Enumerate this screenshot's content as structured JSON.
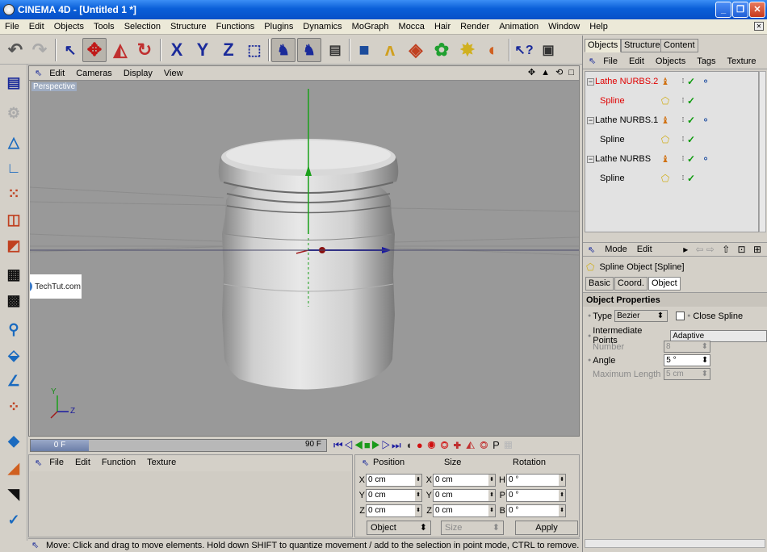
{
  "window": {
    "title": "CINEMA 4D - [Untitled 1 *]",
    "min_glyph": "_",
    "max_glyph": "❐",
    "close_glyph": "✕"
  },
  "menubar": {
    "items": [
      "File",
      "Edit",
      "Objects",
      "Tools",
      "Selection",
      "Structure",
      "Functions",
      "Plugins",
      "Dynamics",
      "MoGraph",
      "Mocca",
      "Hair",
      "Render",
      "Animation",
      "Window",
      "Help"
    ]
  },
  "toolbar": {
    "icons": [
      "undo-icon",
      "redo-icon",
      "pointer-icon",
      "move-icon",
      "scale-icon",
      "rotate-icon",
      "x-axis-icon",
      "y-axis-icon",
      "z-axis-icon",
      "world-coords-icon",
      "render-view-icon",
      "render-picture-icon",
      "render-settings-icon",
      "cube-icon",
      "spline-pen-icon",
      "nurbs-icon",
      "array-icon",
      "deformer-icon",
      "light-icon",
      "scene-icon",
      "help-icon",
      "info-icon"
    ]
  },
  "viewport": {
    "menu": [
      "Edit",
      "Cameras",
      "Display",
      "View"
    ],
    "label": "Perspective",
    "nav_glyphs": [
      "✥",
      "▲",
      "⟲",
      "□"
    ],
    "watermark": "TechTut.com"
  },
  "timeline": {
    "current_frame": "0 F",
    "end_frame": "90 F"
  },
  "material_manager": {
    "menu": [
      "File",
      "Edit",
      "Function",
      "Texture"
    ]
  },
  "coordinates": {
    "headers": [
      "Position",
      "Size",
      "Rotation"
    ],
    "rows": [
      {
        "pos_label": "X",
        "pos": "0 cm",
        "size_label": "X",
        "size": "0 cm",
        "rot_label": "H",
        "rot": "0 °"
      },
      {
        "pos_label": "Y",
        "pos": "0 cm",
        "size_label": "Y",
        "size": "0 cm",
        "rot_label": "P",
        "rot": "0 °"
      },
      {
        "pos_label": "Z",
        "pos": "0 cm",
        "size_label": "Z",
        "size": "0 cm",
        "rot_label": "B",
        "rot": "0 °"
      }
    ],
    "mode": "Object",
    "size_mode": "Size",
    "apply": "Apply"
  },
  "status_bar": {
    "text": "Move: Click and drag to move elements. Hold down SHIFT to quantize movement / add to the selection in point mode, CTRL to remove."
  },
  "object_manager": {
    "tabs": [
      "Objects",
      "Structure",
      "Content"
    ],
    "menu": [
      "File",
      "Edit",
      "Objects",
      "Tags",
      "Texture"
    ],
    "objects": [
      {
        "name": "Lathe NURBS.2",
        "selected": true
      },
      {
        "name": "Spline",
        "selected": true
      },
      {
        "name": "Lathe NURBS.1",
        "selected": false
      },
      {
        "name": "Spline",
        "selected": false
      },
      {
        "name": "Lathe NURBS",
        "selected": false
      },
      {
        "name": "Spline",
        "selected": false
      }
    ],
    "selected_color": "#e00000"
  },
  "attributes": {
    "menu": [
      "Mode",
      "Edit"
    ],
    "object_title": "Spline Object [Spline]",
    "tabs": [
      "Basic",
      "Coord.",
      "Object"
    ],
    "section": "Object Properties",
    "type_label": "Type",
    "type_value": "Bezier",
    "close_spline": "Close Spline",
    "intermediate_label": "Intermediate Points",
    "intermediate_value": "Adaptive",
    "number_label": "Number",
    "number_value": "8",
    "angle_label": "Angle",
    "angle_value": "5 °",
    "max_len_label": "Maximum Length",
    "max_len_value": "5 cm"
  },
  "axis": {
    "x": "X",
    "y": "Y",
    "z": "Z"
  }
}
